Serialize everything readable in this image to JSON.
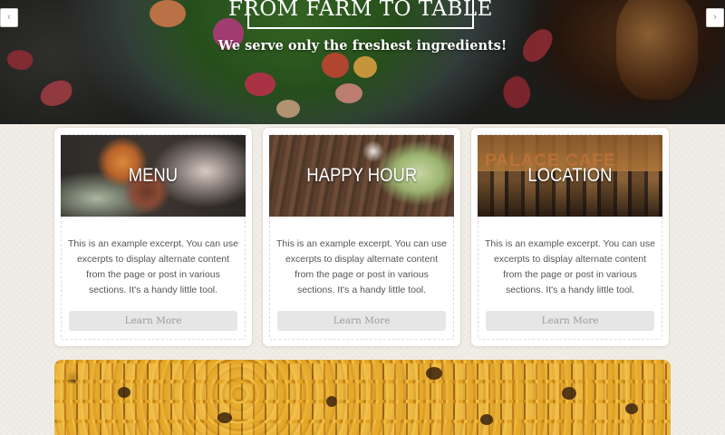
{
  "hero": {
    "title": "FROM FARM TO TABLE",
    "subtitle": "We serve only the freshest ingredients!",
    "prev_icon": "chevron-left-icon",
    "next_icon": "chevron-right-icon",
    "prev_glyph": "‹",
    "next_glyph": "›"
  },
  "cards": [
    {
      "heading": "MENU",
      "excerpt": "This is an example excerpt. You can use excerpts to display alternate content from the page or post in various sections. It's a handy little tool.",
      "button": "Learn More"
    },
    {
      "heading": "HAPPY HOUR",
      "excerpt": "This is an example excerpt. You can use excerpts to display alternate content from the page or post in various sections. It's a handy little tool.",
      "button": "Learn More"
    },
    {
      "heading": "LOCATION",
      "excerpt": "This is an example excerpt. You can use excerpts to display alternate content from the page or post in various sections. It's a handy little tool.",
      "button": "Learn More"
    }
  ],
  "location_sign": "PALACE CAFE",
  "colors": {
    "page_bg": "#f1eee7",
    "card_bg": "#ffffff",
    "button_bg": "#e6e6e6",
    "button_text": "#9b9b9b",
    "body_text": "#555555"
  }
}
